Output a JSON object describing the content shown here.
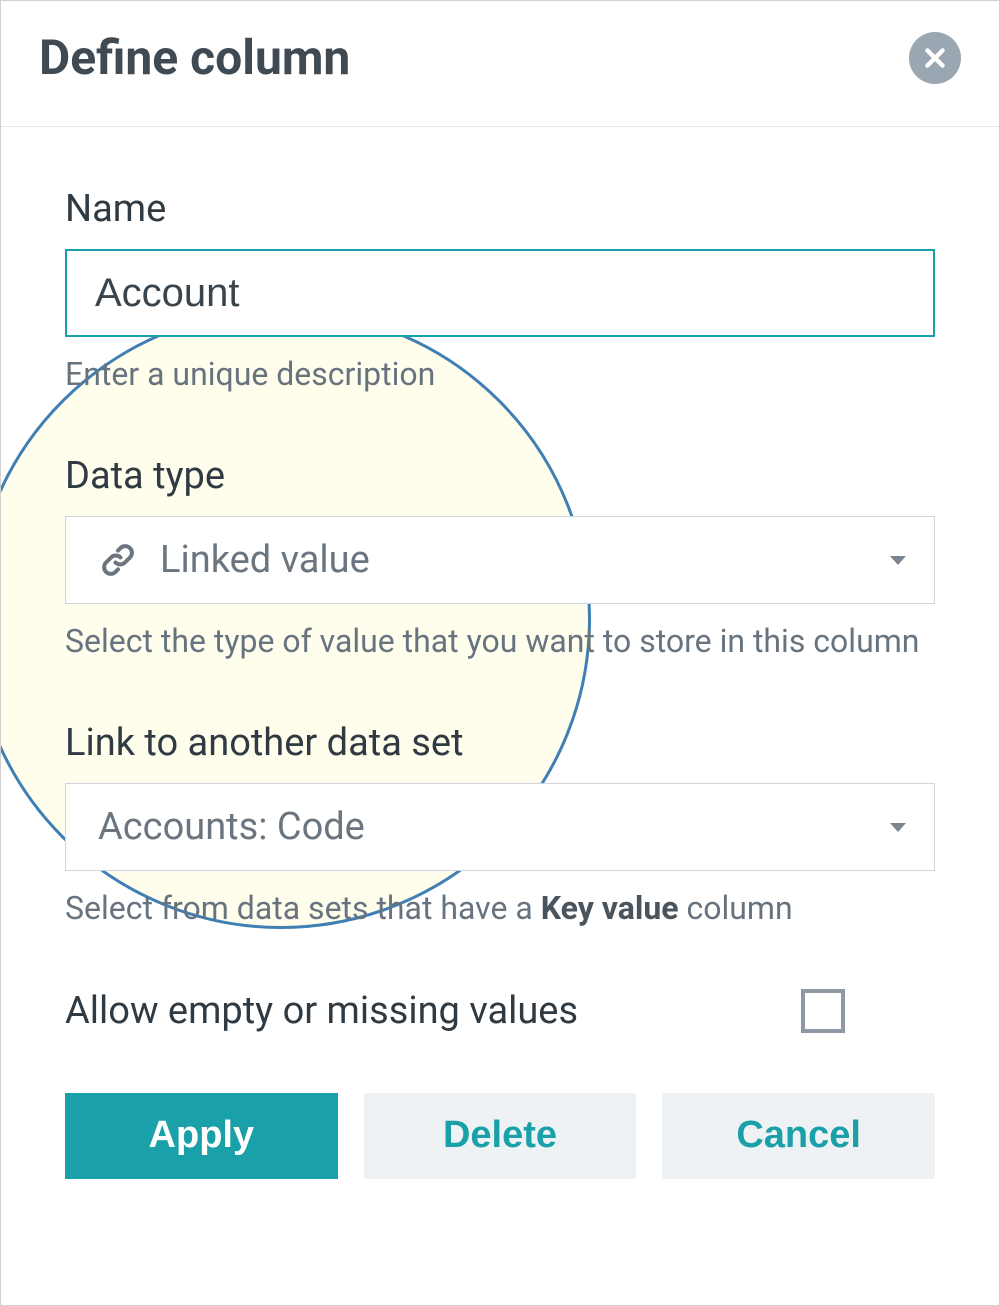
{
  "dialog": {
    "title": "Define column"
  },
  "fields": {
    "name": {
      "label": "Name",
      "value": "Account",
      "help": "Enter a unique description"
    },
    "data_type": {
      "label": "Data type",
      "value": "Linked value",
      "icon": "link-icon",
      "help": "Select the type of value that you want to store in this column"
    },
    "link_to": {
      "label": "Link to another data set",
      "value": "Accounts: Code",
      "help_prefix": "Select from data sets that have a ",
      "help_bold": "Key value",
      "help_suffix": " column"
    },
    "allow_empty": {
      "label": "Allow empty or missing values",
      "checked": false
    }
  },
  "buttons": {
    "apply": "Apply",
    "delete": "Delete",
    "cancel": "Cancel"
  }
}
